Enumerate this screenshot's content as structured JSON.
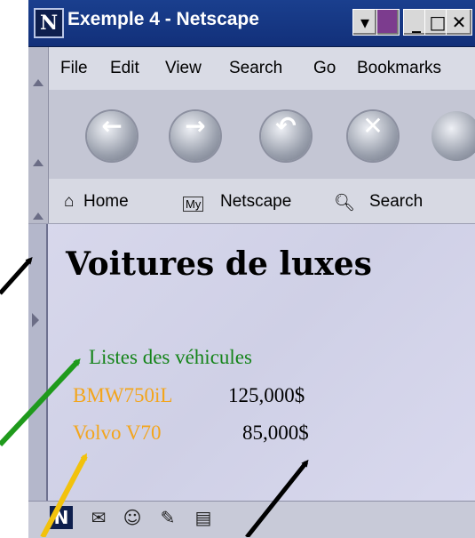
{
  "window": {
    "title": "Exemple 4 - Netscape"
  },
  "menu": {
    "items": [
      "File",
      "Edit",
      "View",
      "Search",
      "Go",
      "Bookmarks"
    ],
    "underline": [
      "F",
      "E",
      "V",
      "S",
      "G",
      "B"
    ]
  },
  "bookmarks": {
    "home": "Home",
    "my": "My",
    "netscape": "Netscape",
    "search": "Search"
  },
  "page": {
    "heading": "Voitures de luxes",
    "list_title": "Listes des véhicules",
    "rows": [
      {
        "name": "BMW750iL",
        "price": "125,000$"
      },
      {
        "name": "Volvo V70",
        "price": "85,000$"
      }
    ]
  },
  "colors": {
    "link_green": "#15841a",
    "link_orange": "#f3a51c",
    "arrow_black": "#000000",
    "arrow_green": "#1f9a1c",
    "arrow_yellow": "#f2c20c"
  },
  "icons": [
    "netscape-logo-icon",
    "back-icon",
    "forward-icon",
    "reload-icon",
    "stop-icon",
    "home-icon",
    "search-icon",
    "mail-icon",
    "composer-icon"
  ]
}
